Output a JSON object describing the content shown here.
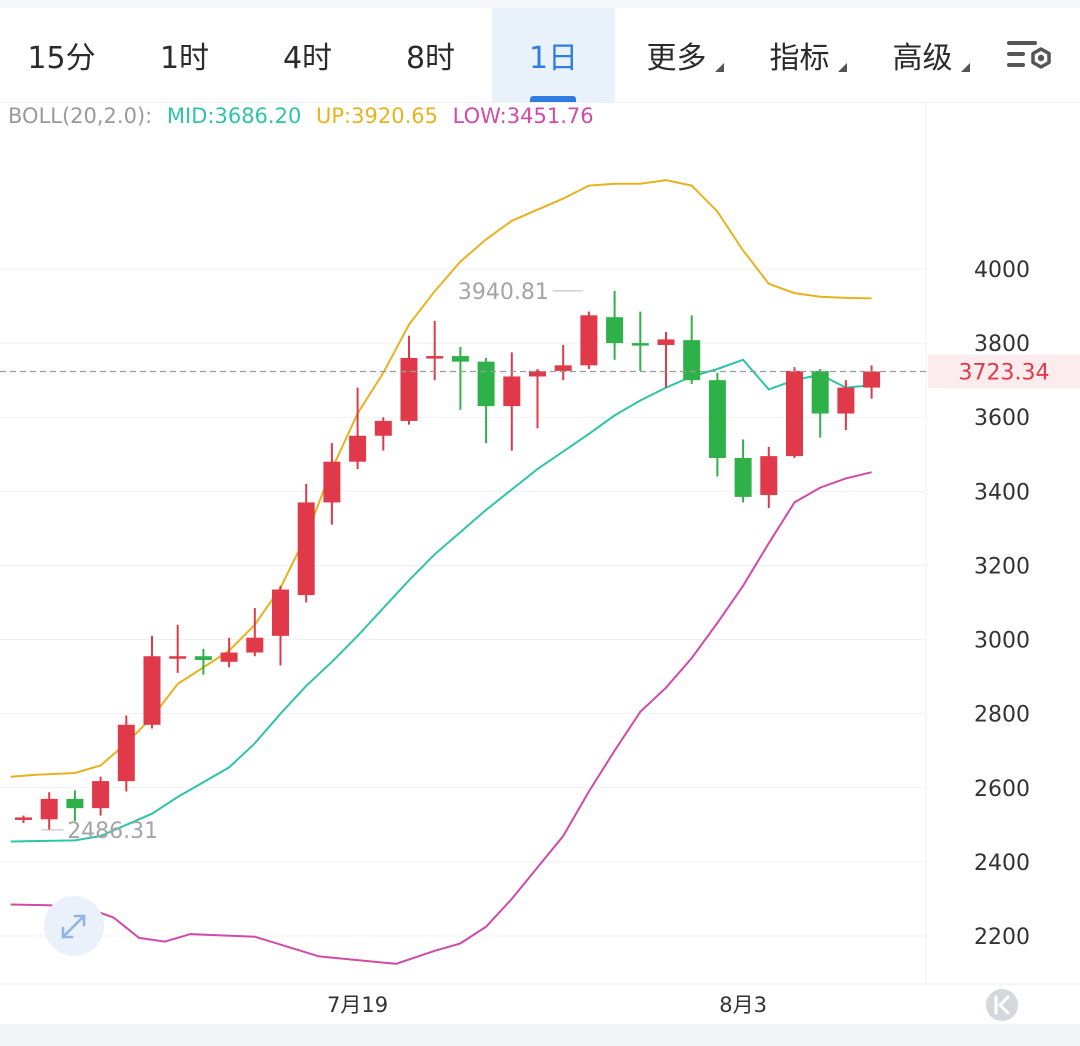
{
  "tabs": [
    {
      "label": "15分",
      "active": false,
      "dropdown": false
    },
    {
      "label": "1时",
      "active": false,
      "dropdown": false
    },
    {
      "label": "4时",
      "active": false,
      "dropdown": false
    },
    {
      "label": "8时",
      "active": false,
      "dropdown": false
    },
    {
      "label": "1日",
      "active": true,
      "dropdown": false
    },
    {
      "label": "更多",
      "active": false,
      "dropdown": true
    },
    {
      "label": "指标",
      "active": false,
      "dropdown": true
    },
    {
      "label": "高级",
      "active": false,
      "dropdown": true
    }
  ],
  "settings_icon": "chart-settings-icon",
  "indicator": {
    "name": "BOLL(20,2.0):",
    "mid": "MID:3686.20",
    "up": "UP:3920.65",
    "low": "LOW:3451.76"
  },
  "colors": {
    "accent": "#2f7de1",
    "up_candle": "#e0394a",
    "down_candle": "#2fb14a",
    "mid_line": "#2ec4a8",
    "up_line": "#e8b21e",
    "low_line": "#d04aa8",
    "indicator_name": "#9a9a9a"
  },
  "chart_data": {
    "type": "candlestick",
    "y_ticks": [
      2200,
      2400,
      2600,
      2800,
      3000,
      3200,
      3400,
      3600,
      3800,
      4000
    ],
    "ylim": [
      2070,
      4300
    ],
    "x_ticks": [
      {
        "label": "7月19",
        "index": 13
      },
      {
        "label": "8月3",
        "index": 28
      }
    ],
    "current_price": "3723.34",
    "max_annotation": {
      "label": "3940.81",
      "value": 3940.81,
      "index": 22
    },
    "min_annotation": {
      "label": "2486.31",
      "value": 2486.31,
      "index": 1
    },
    "candles": [
      {
        "o": 2515,
        "h": 2525,
        "l": 2505,
        "c": 2520
      },
      {
        "o": 2515,
        "h": 2588,
        "l": 2486,
        "c": 2570
      },
      {
        "o": 2570,
        "h": 2593,
        "l": 2510,
        "c": 2545
      },
      {
        "o": 2545,
        "h": 2630,
        "l": 2525,
        "c": 2618
      },
      {
        "o": 2618,
        "h": 2795,
        "l": 2590,
        "c": 2770
      },
      {
        "o": 2770,
        "h": 3010,
        "l": 2760,
        "c": 2955
      },
      {
        "o": 2950,
        "h": 3040,
        "l": 2910,
        "c": 2955
      },
      {
        "o": 2955,
        "h": 2975,
        "l": 2905,
        "c": 2945
      },
      {
        "o": 2940,
        "h": 3005,
        "l": 2925,
        "c": 2965
      },
      {
        "o": 2965,
        "h": 3085,
        "l": 2955,
        "c": 3005
      },
      {
        "o": 3010,
        "h": 3145,
        "l": 2930,
        "c": 3135
      },
      {
        "o": 3120,
        "h": 3420,
        "l": 3100,
        "c": 3370
      },
      {
        "o": 3370,
        "h": 3530,
        "l": 3310,
        "c": 3480
      },
      {
        "o": 3480,
        "h": 3680,
        "l": 3460,
        "c": 3550
      },
      {
        "o": 3550,
        "h": 3600,
        "l": 3510,
        "c": 3590
      },
      {
        "o": 3590,
        "h": 3820,
        "l": 3580,
        "c": 3760
      },
      {
        "o": 3760,
        "h": 3860,
        "l": 3700,
        "c": 3765
      },
      {
        "o": 3765,
        "h": 3790,
        "l": 3620,
        "c": 3750
      },
      {
        "o": 3750,
        "h": 3760,
        "l": 3530,
        "c": 3630
      },
      {
        "o": 3630,
        "h": 3775,
        "l": 3510,
        "c": 3710
      },
      {
        "o": 3710,
        "h": 3730,
        "l": 3570,
        "c": 3725
      },
      {
        "o": 3725,
        "h": 3795,
        "l": 3700,
        "c": 3740
      },
      {
        "o": 3740,
        "h": 3885,
        "l": 3730,
        "c": 3875
      },
      {
        "o": 3870,
        "h": 3940.81,
        "l": 3755,
        "c": 3800
      },
      {
        "o": 3800,
        "h": 3885,
        "l": 3725,
        "c": 3795
      },
      {
        "o": 3795,
        "h": 3830,
        "l": 3680,
        "c": 3810
      },
      {
        "o": 3808,
        "h": 3875,
        "l": 3690,
        "c": 3700
      },
      {
        "o": 3700,
        "h": 3720,
        "l": 3440,
        "c": 3490
      },
      {
        "o": 3490,
        "h": 3540,
        "l": 3370,
        "c": 3385
      },
      {
        "o": 3390,
        "h": 3520,
        "l": 3355,
        "c": 3495
      },
      {
        "o": 3495,
        "h": 3735,
        "l": 3490,
        "c": 3725
      },
      {
        "o": 3725,
        "h": 3730,
        "l": 3545,
        "c": 3610
      },
      {
        "o": 3610,
        "h": 3700,
        "l": 3565,
        "c": 3680
      },
      {
        "o": 3680,
        "h": 3740,
        "l": 3650,
        "c": 3723.34
      }
    ],
    "boll": {
      "up_series": [
        {
          "index": -0.5,
          "value": 2630
        },
        {
          "index": 0.5,
          "value": 2635
        },
        {
          "index": 2,
          "value": 2640
        },
        {
          "index": 3,
          "value": 2660
        },
        {
          "index": 4,
          "value": 2720
        },
        {
          "index": 5,
          "value": 2790
        },
        {
          "index": 6,
          "value": 2880
        },
        {
          "index": 8,
          "value": 2970
        },
        {
          "index": 9,
          "value": 3040
        },
        {
          "index": 10,
          "value": 3140
        },
        {
          "index": 11,
          "value": 3280
        },
        {
          "index": 12,
          "value": 3460
        },
        {
          "index": 13,
          "value": 3610
        },
        {
          "index": 14,
          "value": 3720
        },
        {
          "index": 15,
          "value": 3850
        },
        {
          "index": 16,
          "value": 3940
        },
        {
          "index": 17,
          "value": 4020
        },
        {
          "index": 18,
          "value": 4080
        },
        {
          "index": 19,
          "value": 4130
        },
        {
          "index": 21,
          "value": 4190
        },
        {
          "index": 22,
          "value": 4225
        },
        {
          "index": 23,
          "value": 4230
        },
        {
          "index": 24,
          "value": 4230
        },
        {
          "index": 25,
          "value": 4240
        },
        {
          "index": 26,
          "value": 4225
        },
        {
          "index": 27,
          "value": 4155
        },
        {
          "index": 28,
          "value": 4050
        },
        {
          "index": 29,
          "value": 3960
        },
        {
          "index": 30,
          "value": 3935
        },
        {
          "index": 31,
          "value": 3925
        },
        {
          "index": 32,
          "value": 3922
        },
        {
          "index": 33,
          "value": 3920.65
        }
      ],
      "mid_series": [
        {
          "index": -0.5,
          "value": 2455
        },
        {
          "index": 2,
          "value": 2458
        },
        {
          "index": 3,
          "value": 2470
        },
        {
          "index": 4,
          "value": 2500
        },
        {
          "index": 5,
          "value": 2530
        },
        {
          "index": 6,
          "value": 2575
        },
        {
          "index": 8,
          "value": 2655
        },
        {
          "index": 9,
          "value": 2720
        },
        {
          "index": 10,
          "value": 2800
        },
        {
          "index": 11,
          "value": 2875
        },
        {
          "index": 12,
          "value": 2940
        },
        {
          "index": 13,
          "value": 3010
        },
        {
          "index": 14,
          "value": 3085
        },
        {
          "index": 15,
          "value": 3160
        },
        {
          "index": 16,
          "value": 3230
        },
        {
          "index": 17,
          "value": 3290
        },
        {
          "index": 18,
          "value": 3350
        },
        {
          "index": 19,
          "value": 3405
        },
        {
          "index": 20,
          "value": 3460
        },
        {
          "index": 22,
          "value": 3555
        },
        {
          "index": 23,
          "value": 3605
        },
        {
          "index": 24,
          "value": 3645
        },
        {
          "index": 25,
          "value": 3680
        },
        {
          "index": 26,
          "value": 3710
        },
        {
          "index": 27,
          "value": 3730
        },
        {
          "index": 28,
          "value": 3755
        },
        {
          "index": 29,
          "value": 3675
        },
        {
          "index": 30,
          "value": 3700
        },
        {
          "index": 31,
          "value": 3715
        },
        {
          "index": 32,
          "value": 3680
        },
        {
          "index": 33,
          "value": 3686.2
        }
      ],
      "low_series": [
        {
          "index": -0.5,
          "value": 2285
        },
        {
          "index": 1,
          "value": 2283
        },
        {
          "index": 2.5,
          "value": 2275
        },
        {
          "index": 3.5,
          "value": 2250
        },
        {
          "index": 4.5,
          "value": 2195
        },
        {
          "index": 5.5,
          "value": 2185
        },
        {
          "index": 6.5,
          "value": 2205
        },
        {
          "index": 9,
          "value": 2198
        },
        {
          "index": 11.5,
          "value": 2145
        },
        {
          "index": 13,
          "value": 2135
        },
        {
          "index": 14.5,
          "value": 2125
        },
        {
          "index": 16,
          "value": 2160
        },
        {
          "index": 17,
          "value": 2180
        },
        {
          "index": 18,
          "value": 2225
        },
        {
          "index": 19,
          "value": 2300
        },
        {
          "index": 20,
          "value": 2385
        },
        {
          "index": 21,
          "value": 2470
        },
        {
          "index": 22,
          "value": 2590
        },
        {
          "index": 23,
          "value": 2700
        },
        {
          "index": 24,
          "value": 2805
        },
        {
          "index": 25,
          "value": 2870
        },
        {
          "index": 26,
          "value": 2950
        },
        {
          "index": 27,
          "value": 3045
        },
        {
          "index": 28,
          "value": 3145
        },
        {
          "index": 29,
          "value": 3260
        },
        {
          "index": 30,
          "value": 3370
        },
        {
          "index": 31,
          "value": 3410
        },
        {
          "index": 32,
          "value": 3435
        },
        {
          "index": 33,
          "value": 3451.76
        }
      ]
    }
  }
}
